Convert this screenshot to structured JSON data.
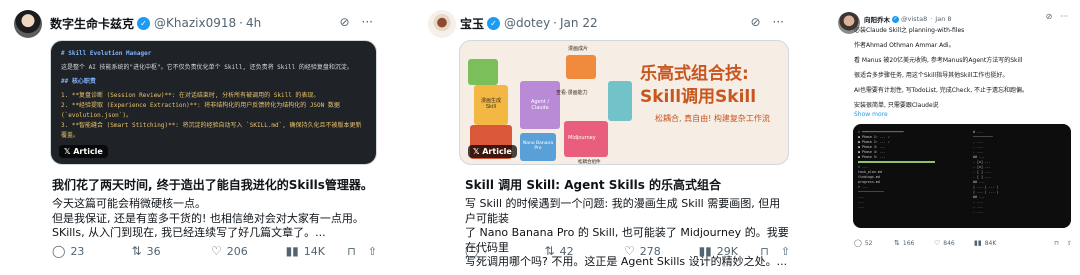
{
  "posts": [
    {
      "author": "数字生命卡兹克",
      "handle": "@Khazix0918",
      "time": "4h",
      "article_tag": "Article",
      "preview_lines": [
        "# Skill Evolution Manager",
        "这是整个 AI 技能系统的\"进化中枢\"。它不仅负责优化单个 Skill, 还负责将 Skill 的经验复盘和沉淀。",
        "## 核心职责",
        "1. **复盘诊断 (Session Review)**: 在对话结束时, 分析所有被调用的 Skill 的表现。",
        "2. **经验提取 (Experience Extraction)**: 将非结构化的用户反馈转化为结构化的 JSON 数据 (`evolution.json`)。",
        "3. **智能缝合 (Smart Stitching)**: 将沉淀的经验自动写入 `SKILL.md`, 确保持久化且不被版本更新覆盖。"
      ],
      "title": "我们花了两天时间, 终于造出了能自我进化的Skills管理器。",
      "body": [
        "今天这篇可能会稍微硬核一点。",
        "但是我保证, 还是有蛮多干货的! 也相信绝对会对大家有一点用。",
        "SKills, 从入门到现在, 我已经连续写了好几篇文章了。..."
      ],
      "replies": "23",
      "reposts": "36",
      "likes": "206",
      "views": "14K"
    },
    {
      "author": "宝玉",
      "handle": "@dotey",
      "time": "Jan 22",
      "article_tag": "Article",
      "art_title_1": "乐高式组合技:",
      "art_title_2": "Skill调用Skill",
      "art_sub": "松耦合, 真自由! 构建复杂工作流",
      "art_labels": [
        "漫画生成 Skill",
        "Agent / Claude",
        "查看·漫画能力",
        "Nano Banana Pro",
        "漫画成片",
        "Midjourney",
        "松耦合组件"
      ],
      "title": "Skill 调用 Skill: Agent Skills 的乐高式组合",
      "body": [
        "写 Skill 的时候遇到一个问题: 我的漫画生成 Skill 需要画图, 但用户可能装",
        "了 Nano Banana Pro 的 Skill, 也可能装了 Midjourney 的。我要在代码里",
        "写死调用哪个吗? 不用。这正是 Agent Skills 设计的精妙之处。..."
      ],
      "replies": "",
      "reposts": "42",
      "likes": "278",
      "views": "29K"
    },
    {
      "author": "向阳乔木",
      "handle": "@vista8",
      "time": "Jan 8",
      "lines": [
        "必装Claude Skill之 planning-with-files",
        "",
        "作者Ahmad Othman Ammar Adi。",
        "",
        "看 Manus 被20亿美元收购, 参考Manus的Agent方法写的Skill",
        "",
        "很适合多步骤任务, 用这个Skill指导其他Skill工作也挺好。",
        "",
        "AI也需要有计划性, 写TodoList, 完成Check, 不止于遗忘和跑偏。",
        "",
        "安装很简单, 只需要跟Claude说"
      ],
      "show_more": "Show more",
      "replies": "52",
      "reposts": "166",
      "likes": "846",
      "views": "84K"
    }
  ],
  "icons": {
    "grok": "grok-icon",
    "more": "more-icon",
    "reply": "reply-icon",
    "repost": "repost-icon",
    "like": "like-icon",
    "views": "views-icon",
    "bookmark": "bookmark-icon",
    "share": "share-icon"
  },
  "colors": {
    "accent": "#1d9bf0",
    "text": "#0f1419",
    "muted": "#536471",
    "orange": "#c7561f"
  }
}
